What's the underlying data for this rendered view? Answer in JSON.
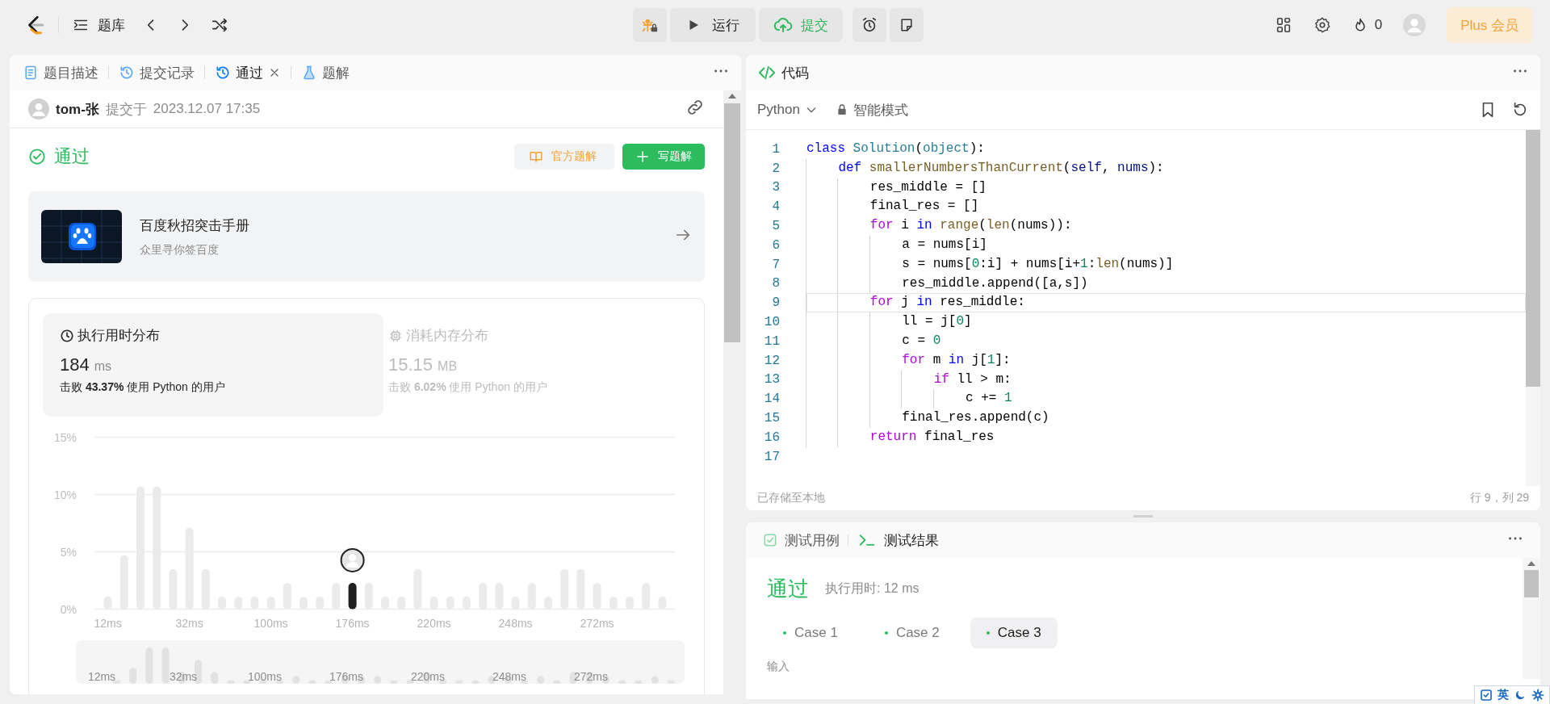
{
  "topbar": {
    "nav_label": "题库",
    "run": "运行",
    "submit": "提交",
    "streak": "0",
    "plus": "Plus 会员"
  },
  "left_panel": {
    "tabs": [
      {
        "label": "题目描述",
        "selected": false,
        "closable": false
      },
      {
        "label": "提交记录",
        "selected": false,
        "closable": false
      },
      {
        "label": "通过",
        "selected": true,
        "closable": true
      },
      {
        "label": "题解",
        "selected": false,
        "closable": false
      }
    ],
    "submission": {
      "user": "tom-张",
      "action": "提交于",
      "time": "2023.12.07 17:35"
    },
    "status": "通过",
    "buttons": [
      {
        "label": "官方题解",
        "kind": "secondary"
      },
      {
        "label": "写题解",
        "kind": "primary"
      }
    ],
    "promo": {
      "title": "百度秋招突击手册",
      "subtitle": "众里寻你签百度"
    },
    "stats": [
      {
        "title": "执行用时分布",
        "value": "184",
        "unit": "ms",
        "beat": "击败 **43.37%** 使用 Python 的用户",
        "selected": true
      },
      {
        "title": "消耗内存分布",
        "value": "15.15",
        "unit": "MB",
        "beat": "击败 **6.02%** 使用 Python 的用户",
        "selected": false
      }
    ],
    "chart_data": {
      "type": "bar",
      "ylim": [
        0,
        15
      ],
      "yticks": [
        {
          "value": 0,
          "label": "0%"
        },
        {
          "value": 5,
          "label": "5%"
        },
        {
          "value": 10,
          "label": "10%"
        },
        {
          "value": 15,
          "label": "15%"
        }
      ],
      "categories": [
        "12ms",
        null,
        null,
        null,
        null,
        "32ms",
        null,
        null,
        null,
        null,
        "100ms",
        null,
        null,
        null,
        null,
        "176ms",
        null,
        null,
        null,
        null,
        "220ms",
        null,
        null,
        null,
        null,
        "248ms",
        null,
        null,
        null,
        null,
        "272ms",
        null,
        null,
        null,
        null
      ],
      "series": [
        {
          "color": "#ebebeb",
          "values": [
            1.1,
            4.7,
            10.7,
            10.7,
            3.5,
            7.1,
            3.5,
            1.1,
            1.1,
            1.1,
            1.1,
            2.3,
            1.1,
            1.1,
            2.3,
            null,
            2.3,
            1.1,
            1.1,
            3.5,
            1.1,
            1.1,
            1.1,
            2.3,
            2.3,
            1.1,
            2.3,
            1.1,
            3.5,
            3.5,
            2.3,
            1.1,
            1.1,
            2.3,
            1.1
          ]
        },
        {
          "color": "#1f1f1f",
          "values": [
            null,
            null,
            null,
            null,
            null,
            null,
            null,
            null,
            null,
            null,
            null,
            null,
            null,
            null,
            null,
            2.3,
            null,
            null,
            null,
            null,
            null,
            null,
            null,
            null,
            null,
            null,
            null,
            null,
            null,
            null,
            null,
            null,
            null,
            null,
            null
          ]
        }
      ]
    },
    "overview": {
      "labels": [
        "12ms",
        "32ms",
        "100ms",
        "176ms",
        "220ms",
        "248ms",
        "272ms"
      ]
    }
  },
  "editor": {
    "title": "代码",
    "language": "Python",
    "mode": "智能模式",
    "lines": [
      {
        "number": "1",
        "current": false,
        "tokens": [
          {
            "text": "class",
            "kind": "kw"
          },
          {
            "text": " Solution",
            "kind": "type"
          },
          {
            "text": "(",
            "kind": "plain"
          },
          {
            "text": "object",
            "kind": "type"
          },
          {
            "text": "):",
            "kind": "plain"
          }
        ]
      },
      {
        "number": "2",
        "current": false,
        "tokens": [
          {
            "text": "    def",
            "kind": "kw"
          },
          {
            "text": " smallerNumbersThanCurrent",
            "kind": "fn"
          },
          {
            "text": "(",
            "kind": "plain"
          },
          {
            "text": "self",
            "kind": "param"
          },
          {
            "text": ", ",
            "kind": "plain"
          },
          {
            "text": "nums",
            "kind": "param"
          },
          {
            "text": "):",
            "kind": "plain"
          }
        ]
      },
      {
        "number": "3",
        "current": false,
        "tokens": [
          {
            "text": "        res_middle = []",
            "kind": "plain"
          }
        ]
      },
      {
        "number": "4",
        "current": false,
        "tokens": [
          {
            "text": "        final_res = []",
            "kind": "plain"
          }
        ]
      },
      {
        "number": "5",
        "current": false,
        "tokens": [
          {
            "text": "        for",
            "kind": "ctrl"
          },
          {
            "text": " i ",
            "kind": "plain"
          },
          {
            "text": "in",
            "kind": "kw"
          },
          {
            "text": " range",
            "kind": "fn"
          },
          {
            "text": "(",
            "kind": "plain"
          },
          {
            "text": "len",
            "kind": "fn"
          },
          {
            "text": "(nums)):",
            "kind": "plain"
          }
        ]
      },
      {
        "number": "6",
        "current": false,
        "tokens": [
          {
            "text": "            a = nums[i]",
            "kind": "plain"
          }
        ]
      },
      {
        "number": "7",
        "current": false,
        "tokens": [
          {
            "text": "            s = nums[",
            "kind": "plain"
          },
          {
            "text": "0",
            "kind": "num"
          },
          {
            "text": ":i] + nums[i+",
            "kind": "plain"
          },
          {
            "text": "1",
            "kind": "num"
          },
          {
            "text": ":",
            "kind": "plain"
          },
          {
            "text": "len",
            "kind": "fn"
          },
          {
            "text": "(nums)]",
            "kind": "plain"
          }
        ]
      },
      {
        "number": "8",
        "current": false,
        "tokens": [
          {
            "text": "            res_middle.append([a,s])",
            "kind": "plain"
          }
        ]
      },
      {
        "number": "9",
        "current": true,
        "tokens": [
          {
            "text": "        for",
            "kind": "ctrl"
          },
          {
            "text": " j ",
            "kind": "plain"
          },
          {
            "text": "in",
            "kind": "kw"
          },
          {
            "text": " res_middle:",
            "kind": "plain"
          }
        ]
      },
      {
        "number": "10",
        "current": false,
        "tokens": [
          {
            "text": "            ll = j[",
            "kind": "plain"
          },
          {
            "text": "0",
            "kind": "num"
          },
          {
            "text": "]",
            "kind": "plain"
          }
        ]
      },
      {
        "number": "11",
        "current": false,
        "tokens": [
          {
            "text": "            c = ",
            "kind": "plain"
          },
          {
            "text": "0",
            "kind": "num"
          }
        ]
      },
      {
        "number": "12",
        "current": false,
        "tokens": [
          {
            "text": "            for",
            "kind": "ctrl"
          },
          {
            "text": " m ",
            "kind": "plain"
          },
          {
            "text": "in",
            "kind": "kw"
          },
          {
            "text": " j[",
            "kind": "plain"
          },
          {
            "text": "1",
            "kind": "num"
          },
          {
            "text": "]:",
            "kind": "plain"
          }
        ]
      },
      {
        "number": "13",
        "current": false,
        "tokens": [
          {
            "text": "                if",
            "kind": "ctrl"
          },
          {
            "text": " ll > m:",
            "kind": "plain"
          }
        ]
      },
      {
        "number": "14",
        "current": false,
        "tokens": [
          {
            "text": "                    c += ",
            "kind": "plain"
          },
          {
            "text": "1",
            "kind": "num"
          }
        ]
      },
      {
        "number": "15",
        "current": false,
        "tokens": [
          {
            "text": "            final_res.append(c)",
            "kind": "plain"
          }
        ]
      },
      {
        "number": "16",
        "current": false,
        "tokens": [
          {
            "text": "        return",
            "kind": "ctrl"
          },
          {
            "text": " final_res",
            "kind": "plain"
          }
        ]
      },
      {
        "number": "17",
        "current": false
      }
    ],
    "saved": "已存储至本地",
    "cursor": "行 9，列 29"
  },
  "console": {
    "tabs": [
      {
        "label": "测试用例",
        "selected": false
      },
      {
        "label": "测试结果",
        "selected": true
      }
    ],
    "result": "通过",
    "runtime": "执行用时: 12 ms",
    "cases": [
      {
        "label": "Case 1",
        "selected": false
      },
      {
        "label": "Case 2",
        "selected": false
      },
      {
        "label": "Case 3",
        "selected": true
      }
    ],
    "input_label": "输入"
  },
  "ime": {
    "label": "英"
  }
}
